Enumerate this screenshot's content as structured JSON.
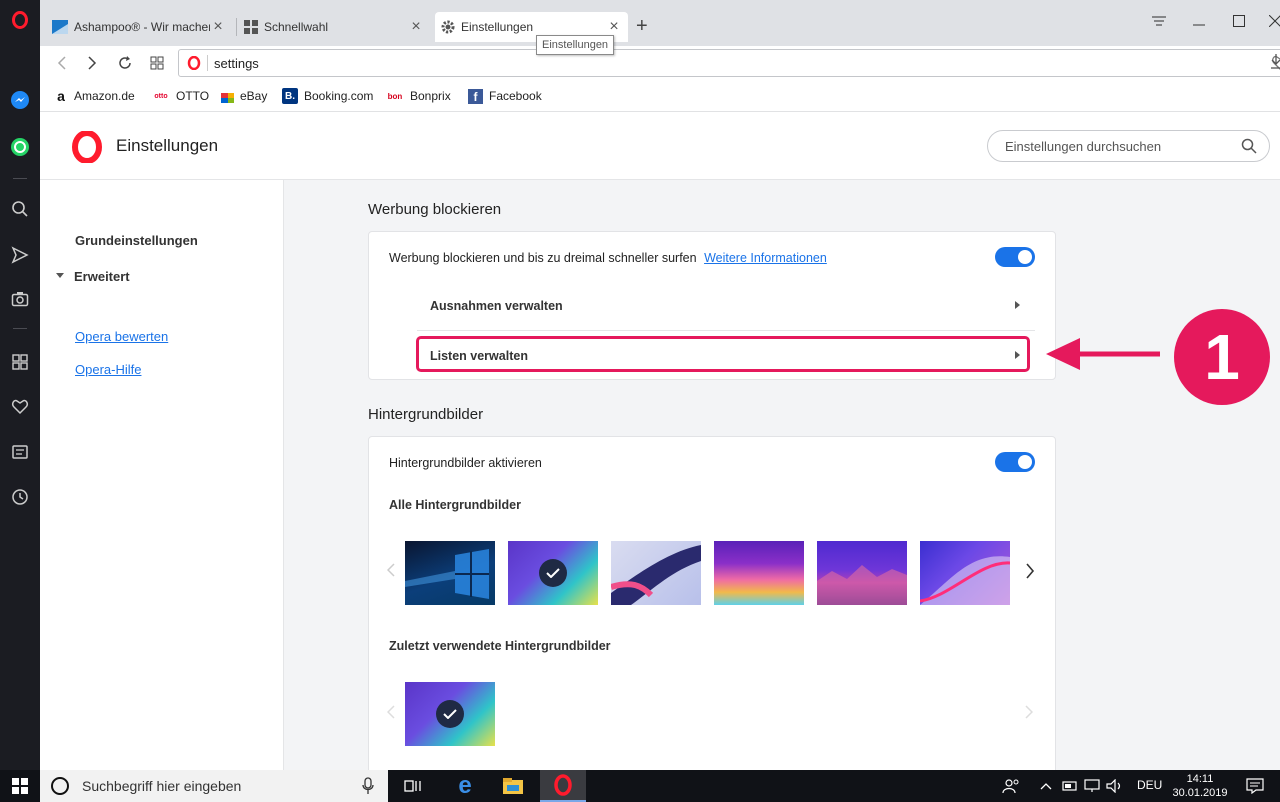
{
  "browser": {
    "tabs": [
      {
        "label": "Ashampoo® - Wir machen",
        "favicon": "ashampoo-icon"
      },
      {
        "label": "Schnellwahl",
        "favicon": "speed-dial-icon"
      },
      {
        "label": "Einstellungen",
        "favicon": "gear-icon"
      }
    ],
    "tooltip": "Einstellungen",
    "url": "settings",
    "bookmarks": [
      {
        "label": "Amazon.de",
        "icon": "amazon-icon"
      },
      {
        "label": "OTTO",
        "icon": "otto-icon"
      },
      {
        "label": "eBay",
        "icon": "ebay-icon"
      },
      {
        "label": "Booking.com",
        "icon": "booking-icon"
      },
      {
        "label": "Bonprix",
        "icon": "bonprix-icon"
      },
      {
        "label": "Facebook",
        "icon": "facebook-icon"
      }
    ]
  },
  "settings": {
    "title": "Einstellungen",
    "search_placeholder": "Einstellungen durchsuchen",
    "nav": {
      "basic": "Grundeinstellungen",
      "advanced": "Erweitert",
      "rate": "Opera bewerten",
      "help": "Opera-Hilfe"
    },
    "adblock": {
      "section_title": "Werbung blockieren",
      "toggle_label": "Werbung blockieren und bis zu dreimal schneller surfen",
      "more_info": "Weitere Informationen",
      "enabled": true,
      "exceptions": "Ausnahmen verwalten",
      "lists": "Listen verwalten"
    },
    "wallpapers": {
      "section_title": "Hintergrundbilder",
      "toggle_label": "Hintergrundbilder aktivieren",
      "enabled": true,
      "all_title": "Alle Hintergrundbilder",
      "recent_title": "Zuletzt verwendete Hintergrundbilder"
    }
  },
  "annotation": {
    "number": "1",
    "color": "#e5195c"
  },
  "taskbar": {
    "search_placeholder": "Suchbegriff hier eingeben",
    "language": "DEU",
    "time": "14:11",
    "date": "30.01.2019"
  }
}
